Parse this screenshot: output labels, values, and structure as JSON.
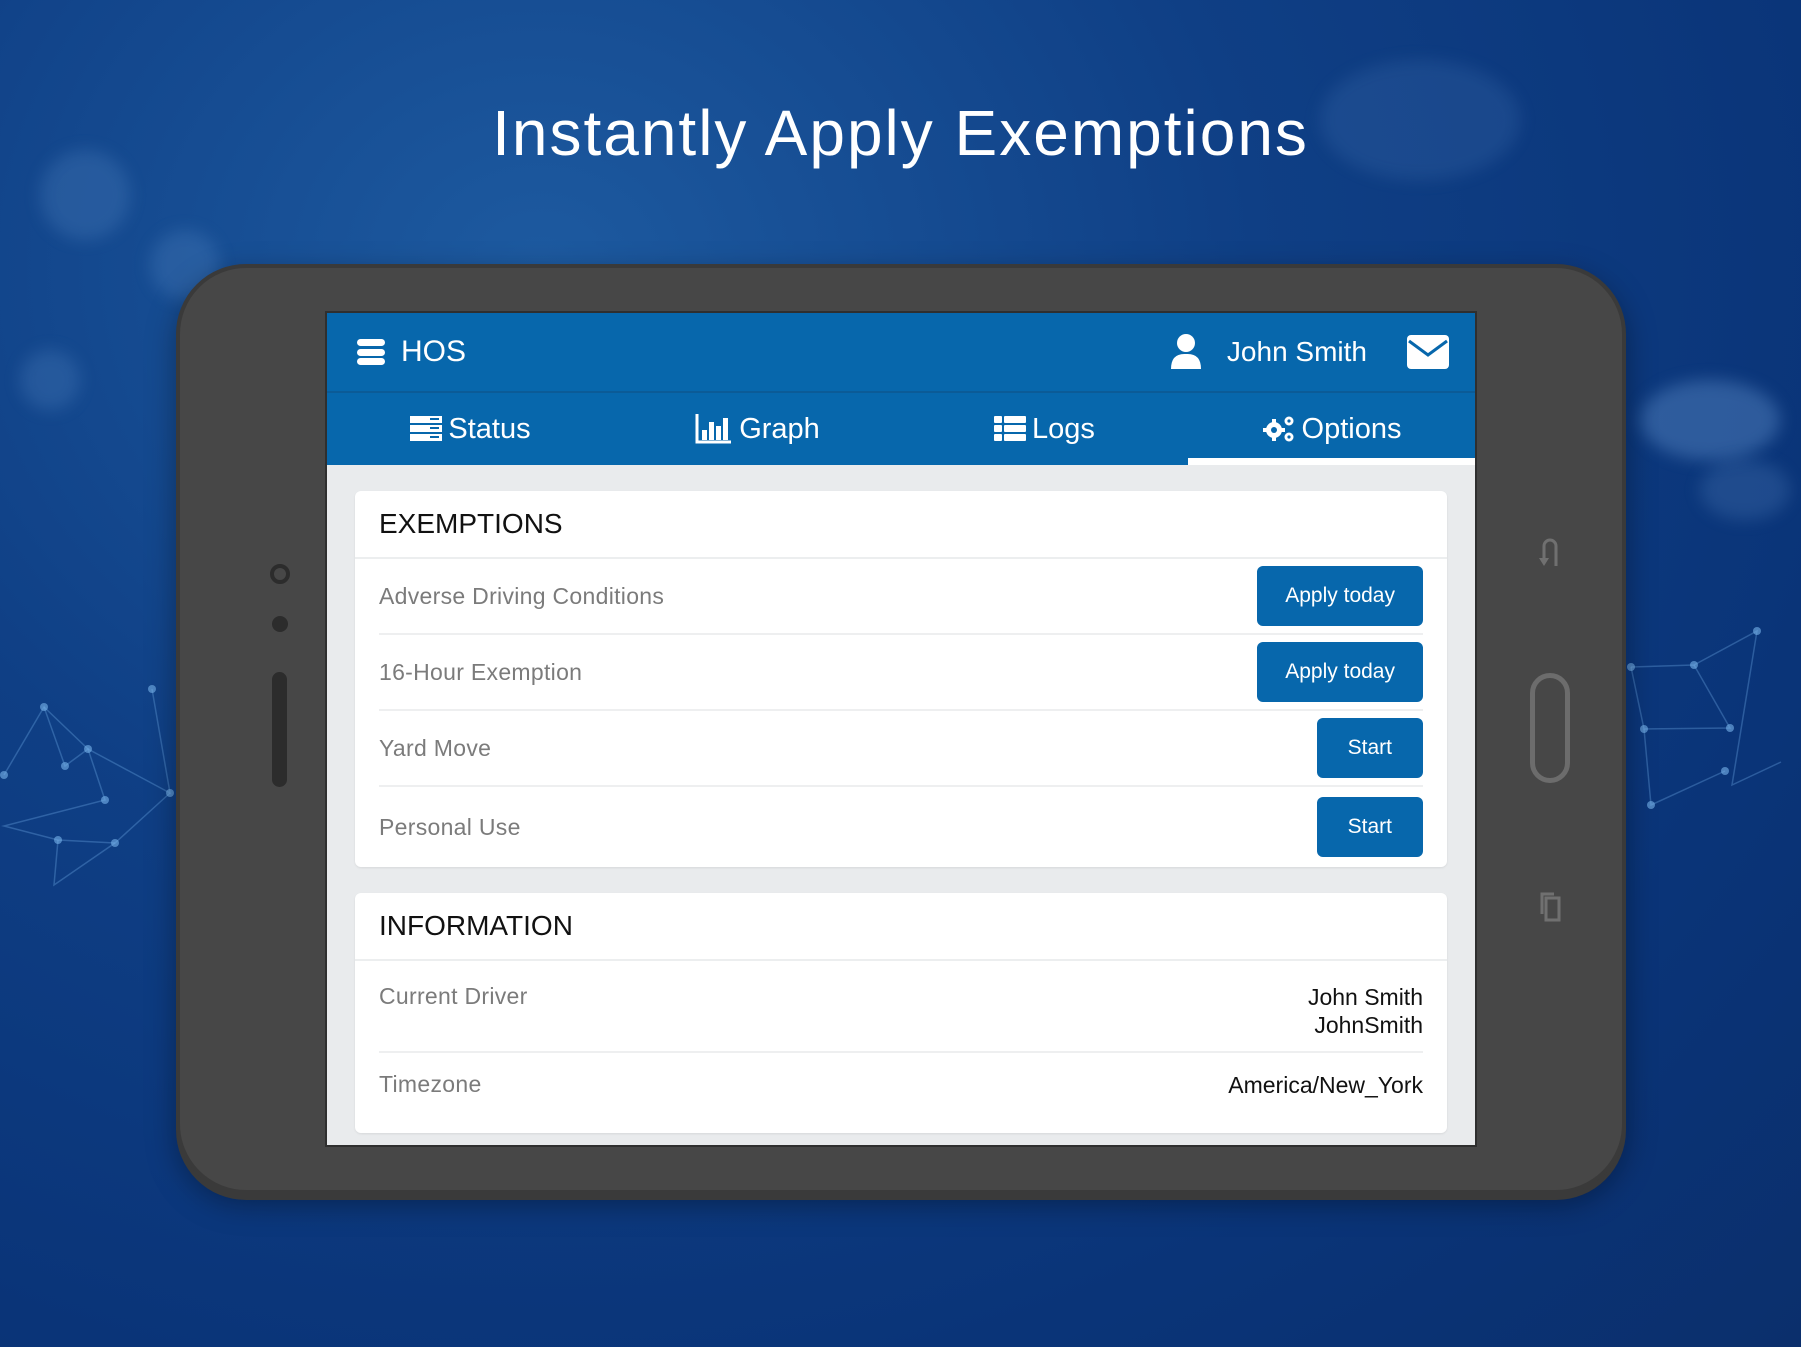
{
  "headline": "Instantly Apply Exemptions",
  "app": {
    "title": "HOS",
    "user_name": "John Smith",
    "icons": {
      "menu": "hamburger-menu-icon",
      "user": "user-icon",
      "mail": "envelope-icon"
    }
  },
  "tabs": [
    {
      "label": "Status",
      "icon": "server-list-icon",
      "active": false
    },
    {
      "label": "Graph",
      "icon": "bar-chart-icon",
      "active": false
    },
    {
      "label": "Logs",
      "icon": "list-icon",
      "active": false
    },
    {
      "label": "Options",
      "icon": "gears-icon",
      "active": true
    }
  ],
  "exemptions": {
    "title": "EXEMPTIONS",
    "items": [
      {
        "label": "Adverse Driving Conditions",
        "button": "Apply today"
      },
      {
        "label": "16-Hour Exemption",
        "button": "Apply today"
      },
      {
        "label": "Yard Move",
        "button": "Start"
      },
      {
        "label": "Personal Use",
        "button": "Start"
      }
    ]
  },
  "information": {
    "title": "INFORMATION",
    "items": [
      {
        "label": "Current Driver",
        "value_line1": "John Smith",
        "value_line2": "JohnSmith"
      },
      {
        "label": "Timezone",
        "value_line1": "America/New_York"
      }
    ]
  },
  "colors": {
    "primary": "#0767ac",
    "background": "#0f3f85",
    "device": "#474747"
  }
}
